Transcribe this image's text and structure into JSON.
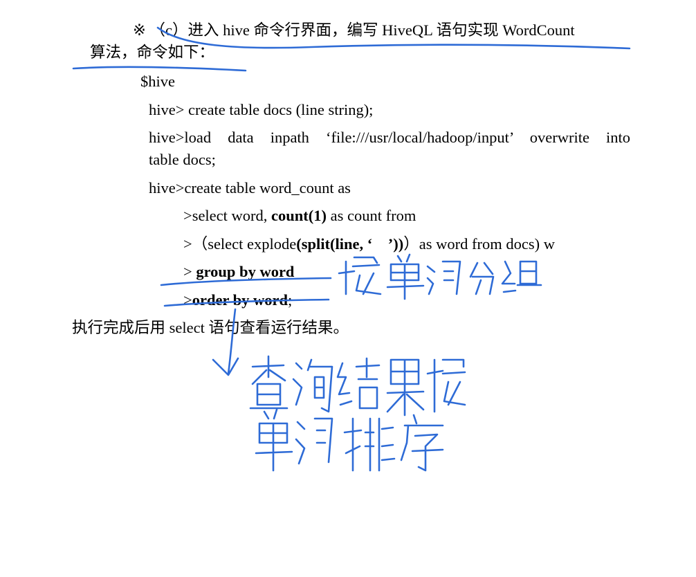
{
  "document": {
    "intro_line1": "※ （c）进入 hive 命令行界面，编写 HiveQL 语句实现 WordCount",
    "intro_line2": "算法，命令如下：",
    "shell_prompt": "$hive",
    "cmd_create_docs": "hive> create table docs (line string);",
    "cmd_load_part1": "hive>load data inpath ‘file:///usr/local/hadoop/input’ overwrite into",
    "cmd_load_part2": "table docs;",
    "cmd_create_wc": "hive>create table word_count as",
    "cmd_select": {
      "prefix": ">select word, ",
      "bold": "count(1)",
      "suffix": " as count from"
    },
    "cmd_subquery": {
      "prefix": ">（select explode",
      "bold": "(split(line, ‘    ’))",
      "suffix": "）as word from docs) w"
    },
    "cmd_group": {
      "prefix": "> ",
      "bold": "group by word"
    },
    "cmd_order": {
      "prefix": ">",
      "bold": "order by word",
      "suffix": ";"
    },
    "conclusion": "执行完成后用 select 语句查看运行结果。"
  },
  "handwritten_notes": {
    "note_group": "按单词分组",
    "note_order_line1": "查询结果按",
    "note_order_line2": "单词排序",
    "ink_color": "#2e6bd6"
  }
}
